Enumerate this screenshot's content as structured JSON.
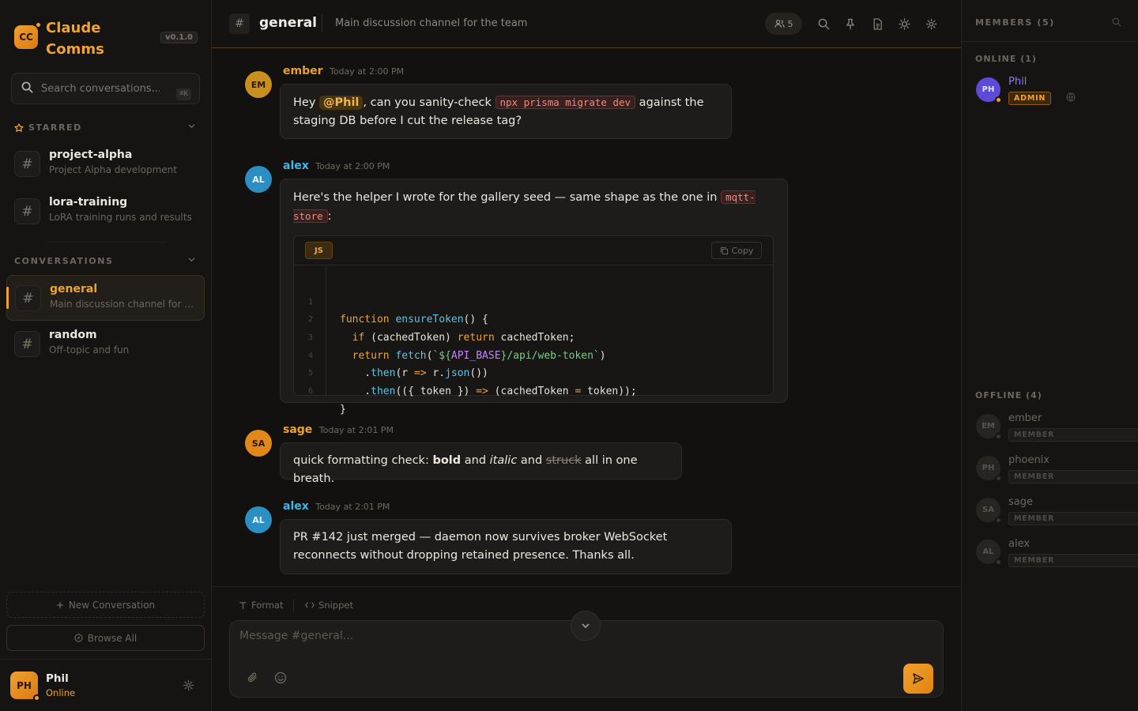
{
  "app": {
    "logo_initials": "CC",
    "name": "Claude Comms",
    "version": "v0.1.0"
  },
  "search": {
    "placeholder": "Search conversations...",
    "shortcut": "⌘K"
  },
  "sidebar": {
    "starred_label": "STARRED",
    "conversations_label": "CONVERSATIONS",
    "starred": [
      {
        "name": "project-alpha",
        "desc": "Project Alpha development"
      },
      {
        "name": "lora-training",
        "desc": "LoRA training runs and results"
      }
    ],
    "conversations": [
      {
        "name": "general",
        "desc": "Main discussion channel for the team",
        "active": true
      },
      {
        "name": "random",
        "desc": "Off-topic and fun",
        "active": false
      }
    ],
    "new_conversation": "New Conversation",
    "browse_all": "Browse All"
  },
  "current_user": {
    "initials": "PH",
    "name": "Phil",
    "status": "Online"
  },
  "channel": {
    "name": "general",
    "description": "Main discussion channel for the team",
    "member_count": "5"
  },
  "messages": [
    {
      "author": "ember",
      "initials": "EM",
      "time": "Today at 2:00 PM",
      "parts": {
        "t1": "Hey ",
        "mention": "@Phil",
        "t2": ", can you sanity-check ",
        "code": "npx prisma migrate dev",
        "t3": " against the staging DB before I cut the release tag?"
      }
    },
    {
      "author": "alex",
      "initials": "AL",
      "time": "Today at 2:00 PM",
      "parts": {
        "t1": "Here's the helper I wrote for the gallery seed — same shape as the one in ",
        "code": "mqtt-store",
        "t2": ":"
      },
      "code_block": {
        "lang": "JS",
        "copy_label": "Copy",
        "line_numbers": [
          "1",
          "2",
          "3",
          "4",
          "5",
          "6"
        ],
        "lines": [
          "function ensureToken() {",
          "  if (cachedToken) return cachedToken;",
          "  return fetch(`${API_BASE}/api/web-token`)",
          "    .then(r => r.json())",
          "    .then(({ token }) => (cachedToken = token));",
          "}"
        ]
      }
    },
    {
      "author": "sage",
      "initials": "SA",
      "time": "Today at 2:01 PM",
      "parts": {
        "t1": "quick formatting check: ",
        "bold": "bold",
        "t2": " and ",
        "italic": "italic",
        "t3": " and ",
        "strike": "struck",
        "t4": " all in one breath."
      }
    },
    {
      "author": "alex",
      "initials": "AL",
      "time": "Today at 2:01 PM",
      "text": "PR #142 just merged — daemon now survives broker WebSocket reconnects without dropping retained presence. Thanks all."
    }
  ],
  "composer": {
    "format_label": "Format",
    "snippet_label": "Snippet",
    "placeholder": "Message #general..."
  },
  "members_panel": {
    "title": "MEMBERS (5)",
    "online_label": "ONLINE (1)",
    "offline_label": "OFFLINE (4)",
    "online": [
      {
        "initials": "PH",
        "name": "Phil",
        "role": "ADMIN"
      }
    ],
    "offline": [
      {
        "initials": "EM",
        "name": "ember",
        "role": "MEMBER"
      },
      {
        "initials": "PH",
        "name": "phoenix",
        "role": "MEMBER"
      },
      {
        "initials": "SA",
        "name": "sage",
        "role": "MEMBER"
      },
      {
        "initials": "AL",
        "name": "alex",
        "role": "MEMBER"
      }
    ]
  },
  "colors": {
    "accent": "#f0a330",
    "ember": "#e8a12e",
    "alex": "#3fb6e6",
    "sage": "#f0a330",
    "phil": "#8b7cf6"
  }
}
